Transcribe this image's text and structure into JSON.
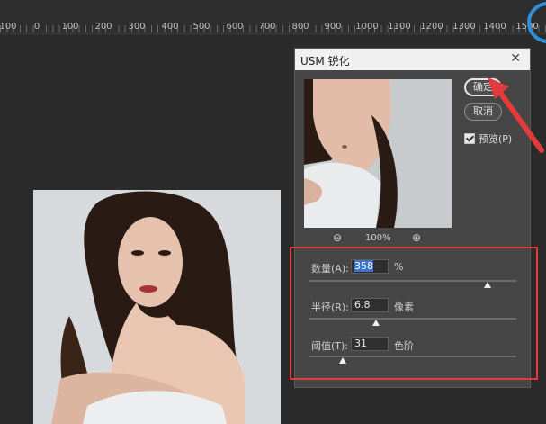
{
  "ruler": {
    "labels": [
      "100",
      "0",
      "100",
      "200",
      "300",
      "400",
      "500",
      "600",
      "700",
      "800",
      "900",
      "1000",
      "1100",
      "1200",
      "1300",
      "1400",
      "1500"
    ]
  },
  "dialog": {
    "title": "USM 锐化",
    "ok_label": "确定",
    "cancel_label": "取消",
    "preview_label": "预览(P)",
    "preview_checked": true,
    "zoom_level": "100%",
    "amount": {
      "label": "数量(A):",
      "value": "358",
      "unit": "%",
      "slider_fraction": 0.86
    },
    "radius": {
      "label": "半径(R):",
      "value": "6.8",
      "unit": "像素",
      "slider_fraction": 0.32
    },
    "threshold": {
      "label": "阈值(T):",
      "value": "31",
      "unit": "色阶",
      "slider_fraction": 0.16
    }
  },
  "colors": {
    "highlight": "#e23b3b",
    "accent_blue": "#2f8fd8"
  },
  "icons": {
    "zoom_out": "zoom-out-icon",
    "zoom_in": "zoom-in-icon",
    "close": "close-icon"
  }
}
